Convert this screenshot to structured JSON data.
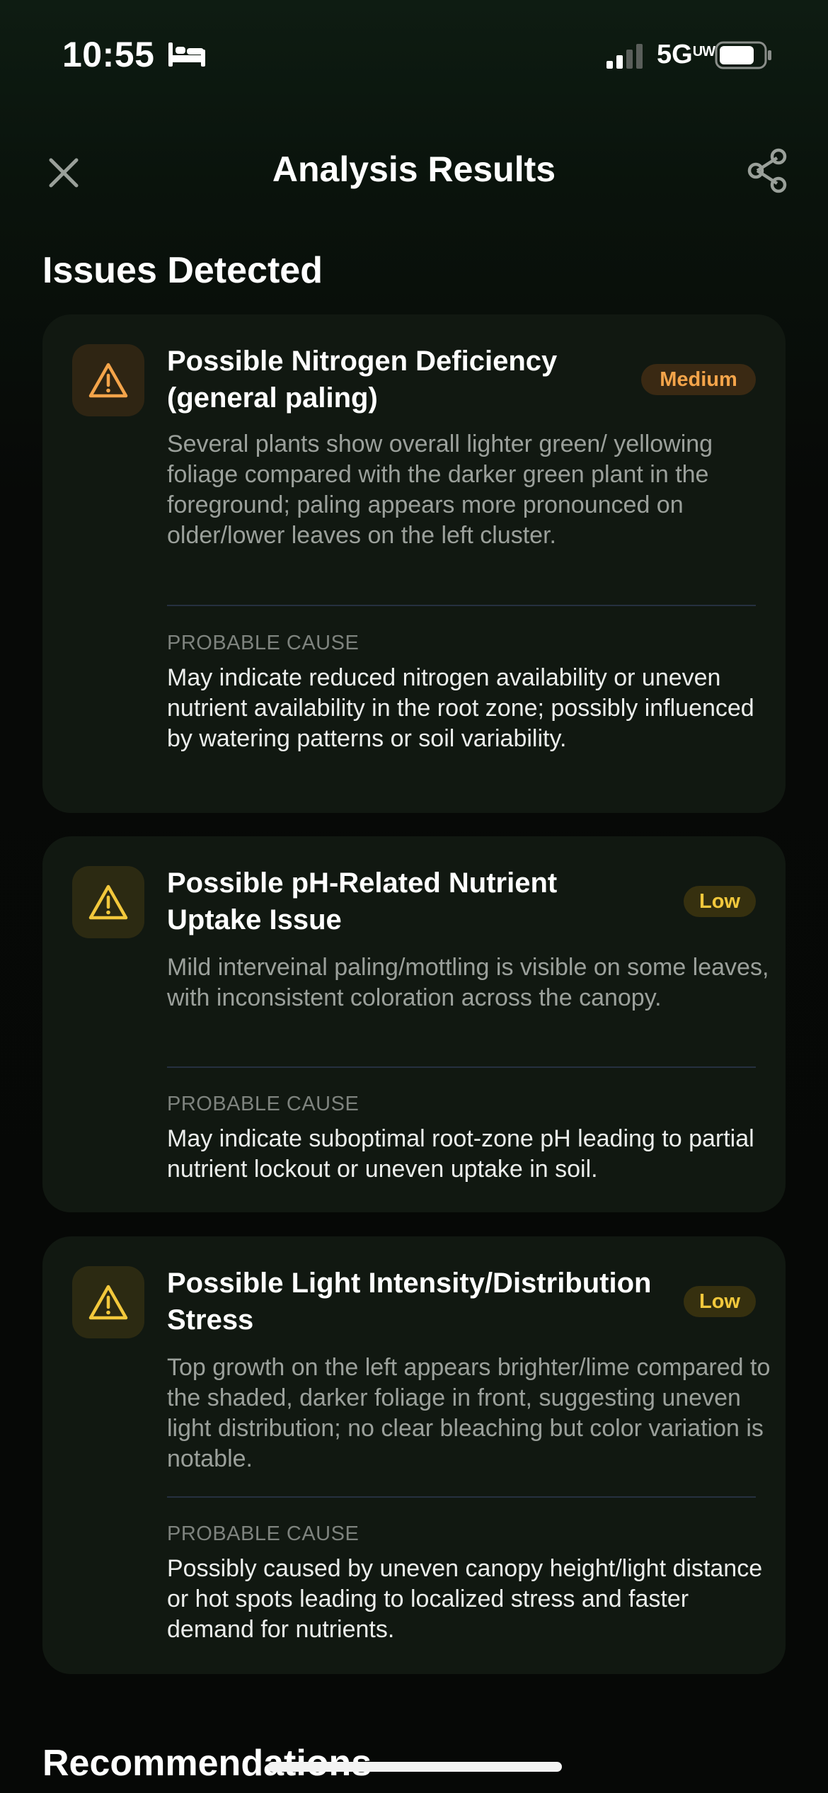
{
  "status_bar": {
    "time": "10:55",
    "network": "5G",
    "network_suffix": "UW",
    "icons": [
      "bed-icon",
      "signal-icon",
      "battery-icon"
    ]
  },
  "header": {
    "title": "Analysis Results",
    "close_icon": "close-icon",
    "share_icon": "share-icon"
  },
  "sections": {
    "issues_title": "Issues Detected",
    "recommendations_title": "Recommendations"
  },
  "issues": [
    {
      "title": "Possible Nitrogen Deficiency (general paling)",
      "severity": "Medium",
      "description": "Several plants show overall lighter green/ yellowing foliage compared with the darker green plant in the foreground; paling appears more pronounced on older/lower leaves on the left cluster.",
      "cause_label": "PROBABLE CAUSE",
      "cause": "May indicate reduced nitrogen availability or uneven nutrient availability in the root zone; possibly influenced by watering patterns or soil variability."
    },
    {
      "title": "Possible pH-Related Nutrient Uptake Issue",
      "severity": "Low",
      "description": "Mild interveinal paling/mottling is visible on some leaves, with inconsistent coloration across the canopy.",
      "cause_label": "PROBABLE CAUSE",
      "cause": "May indicate suboptimal root-zone pH leading to partial nutrient lockout or uneven uptake in soil."
    },
    {
      "title": "Possible Light Intensity/Distribution Stress",
      "severity": "Low",
      "description": "Top growth on the left appears brighter/lime compared to the shaded, darker foliage in front, suggesting uneven light distribution; no clear bleaching but color variation is notable.",
      "cause_label": "PROBABLE CAUSE",
      "cause": "Possibly caused by uneven canopy height/light distance or hot spots leading to localized stress and faster demand for nutrients."
    }
  ],
  "colors": {
    "medium_accent": "#f4a44a",
    "low_accent": "#f2c83c",
    "card_background": "#111811"
  }
}
